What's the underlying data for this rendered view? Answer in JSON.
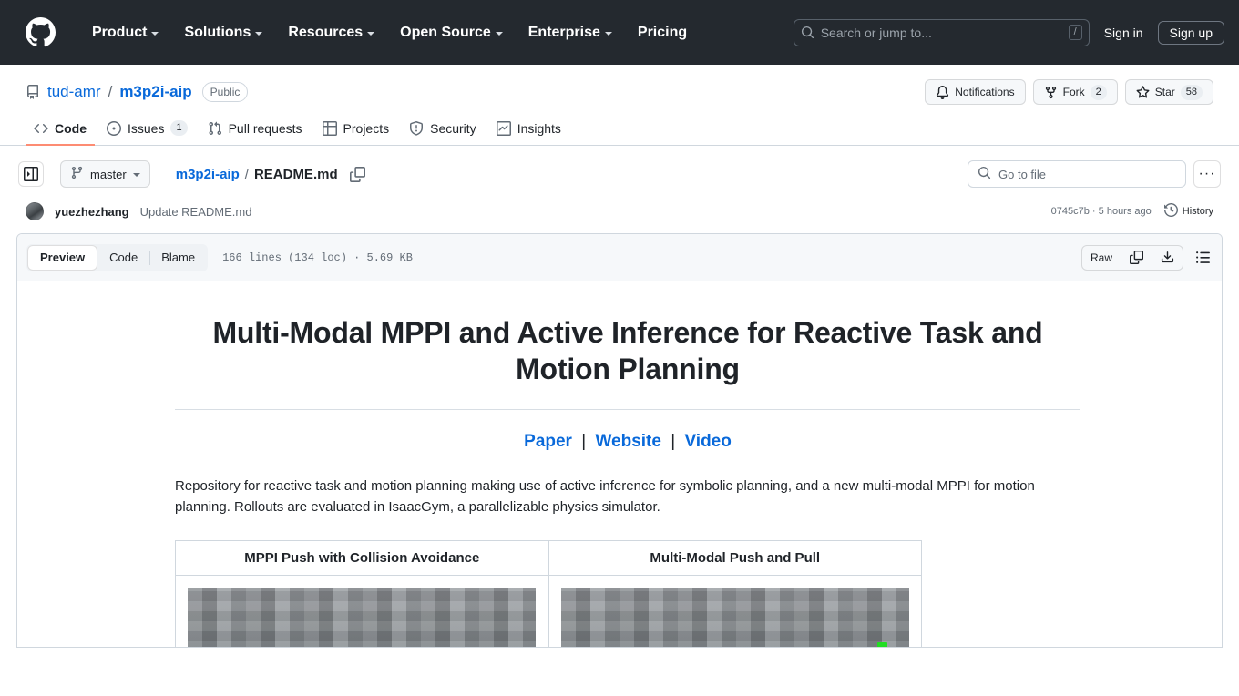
{
  "global_header": {
    "logo_icon": "github-mark-icon",
    "nav": [
      {
        "label": "Product",
        "has_caret": true
      },
      {
        "label": "Solutions",
        "has_caret": true
      },
      {
        "label": "Resources",
        "has_caret": true
      },
      {
        "label": "Open Source",
        "has_caret": true
      },
      {
        "label": "Enterprise",
        "has_caret": true
      },
      {
        "label": "Pricing",
        "has_caret": false
      }
    ],
    "search": {
      "placeholder": "Search or jump to...",
      "shortcut": "/",
      "icon": "search-icon"
    },
    "sign_in": "Sign in",
    "sign_up": "Sign up"
  },
  "repo": {
    "icon": "repo-icon",
    "owner": "tud-amr",
    "separator": "/",
    "name": "m3p2i-aip",
    "visibility": "Public",
    "actions": [
      {
        "label": "Notifications",
        "icon": "bell-icon",
        "count": null
      },
      {
        "label": "Fork",
        "icon": "fork-icon",
        "count": "2"
      },
      {
        "label": "Star",
        "icon": "star-icon",
        "count": "58"
      }
    ]
  },
  "tabs": [
    {
      "label": "Code",
      "icon": "code-icon",
      "count": null,
      "active": true
    },
    {
      "label": "Issues",
      "icon": "issue-opened-icon",
      "count": "1",
      "active": false
    },
    {
      "label": "Pull requests",
      "icon": "git-pull-request-icon",
      "count": null,
      "active": false
    },
    {
      "label": "Projects",
      "icon": "table-icon",
      "count": null,
      "active": false
    },
    {
      "label": "Security",
      "icon": "shield-icon",
      "count": null,
      "active": false
    },
    {
      "label": "Insights",
      "icon": "graph-icon",
      "count": null,
      "active": false
    }
  ],
  "file_nav": {
    "sidebar_toggle_icon": "sidebar-expand-icon",
    "branch": "master",
    "branch_icon": "git-branch-icon",
    "breadcrumb_repo": "m3p2i-aip",
    "breadcrumb_sep": "/",
    "breadcrumb_file": "README.md",
    "copy_path_icon": "copy-icon",
    "go_to_file_placeholder": "Go to file",
    "go_to_file_icon": "search-icon",
    "more_options": "···"
  },
  "commit": {
    "avatar": "user-avatar",
    "author": "yuezhezhang",
    "message": "Update README.md",
    "hash_and_time": "0745c7b · 5 hours ago",
    "history_label": "History",
    "history_icon": "history-icon"
  },
  "file_view": {
    "view_tabs": [
      {
        "label": "Preview",
        "active": true
      },
      {
        "label": "Code",
        "active": false
      },
      {
        "label": "Blame",
        "active": false
      }
    ],
    "stats": "166 lines (134 loc) · 5.69 KB",
    "raw_label": "Raw",
    "copy_icon": "copy-raw-icon",
    "download_icon": "download-icon",
    "outline_icon": "outline-list-icon"
  },
  "readme": {
    "title": "Multi-Modal MPPI and Active Inference for Reactive Task and Motion Planning",
    "links": [
      {
        "label": "Paper"
      },
      {
        "label": "Website"
      },
      {
        "label": "Video"
      }
    ],
    "link_separator": "|",
    "paragraph": "Repository for reactive task and motion planning making use of active inference for symbolic planning, and a new multi-modal MPPI for motion planning. Rollouts are evaluated in IsaacGym, a parallelizable physics simulator.",
    "table": {
      "headers": [
        "MPPI Push with Collision Avoidance",
        "Multi-Modal Push and Pull"
      ],
      "cells": [
        {
          "caption": "MPPI Push with Collision Avoidance",
          "has_green_marker": false
        },
        {
          "caption": "Multi-Modal Push and Pull",
          "has_green_marker": true
        }
      ]
    }
  },
  "colors": {
    "header_bg": "#24292f",
    "accent_link": "#0969da",
    "active_tab_underline": "#fd8c73",
    "border": "#d0d7de",
    "muted_text": "#636c76",
    "green_marker": "#22dd22"
  }
}
